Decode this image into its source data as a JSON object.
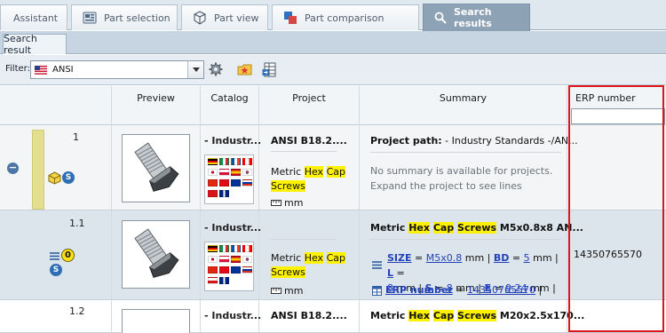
{
  "tabs": [
    {
      "label": "Assistant"
    },
    {
      "label": "Part selection"
    },
    {
      "label": "Part view"
    },
    {
      "label": "Part comparison"
    },
    {
      "label": "Search results"
    }
  ],
  "subtab": {
    "label": "Search result"
  },
  "filter": {
    "label": "Filter:",
    "value": "ANSI"
  },
  "columns": {
    "preview": "Preview",
    "catalog": "Catalog",
    "project": "Project",
    "summary": "Summary",
    "erp": "ERP number"
  },
  "rows": [
    {
      "index": "1",
      "catalog": "- Industr...",
      "project_title": "ANSI B18.2....",
      "project_sub_prefix": "Metric ",
      "hl1": "Hex",
      "hl2": "Cap",
      "hl3": "Screws",
      "unit": "mm",
      "summary_label": "Project path:",
      "summary_path": " - Industry Standards -/AN...",
      "summary_note1": "No summary is available for projects.",
      "summary_note2": "Expand the project to see lines",
      "erp": ""
    },
    {
      "index": "1.1",
      "badge": "0",
      "catalog": "- Industr...",
      "project_prefix": "Metric ",
      "hl1": "Hex",
      "hl2": "Cap",
      "hl3": "Screws",
      "unit": "mm",
      "summary_title_prefix": "Metric ",
      "summary_title_suffix": " M5x0.8x8 AN...",
      "attr_size_k": "SIZE",
      "attr_size_v": "M5x0.8",
      "attr_mm1": " mm | ",
      "attr_bd_k": "BD",
      "attr_bd_v": "5",
      "attr_mm2": " mm | ",
      "attr_l_k": "L",
      "attr_l_v": "8",
      "attr_mm3": " mm | ",
      "attr_s_k": "S",
      "attr_s_v": "8",
      "attr_mm4": " mm | ",
      "attr_e_k": "E",
      "attr_e_v": "9.24",
      "attr_mm5": " mm |",
      "erp_k": "ERP number",
      "erp_v": "14350765570",
      "erp_tail": " |",
      "erp": "14350765570"
    },
    {
      "index": "1.2",
      "catalog": "- Industr...",
      "project_title": "ANSI B18.2....",
      "summary_title_prefix": "Metric ",
      "summary_title_suffix": " M20x2.5x170..."
    }
  ],
  "colors": {
    "highlight": "#fff200",
    "annotation": "#e0141c",
    "link": "#2342b8",
    "active_tab": "#8ea2b5"
  },
  "icons": [
    "search-icon",
    "settings-gear-icon",
    "folder-star-icon",
    "export-table-icon",
    "cube-icon",
    "s-badge-icon",
    "lines-icon",
    "zero-badge-icon",
    "collapse-icon",
    "ruler-icon",
    "table-icon"
  ]
}
